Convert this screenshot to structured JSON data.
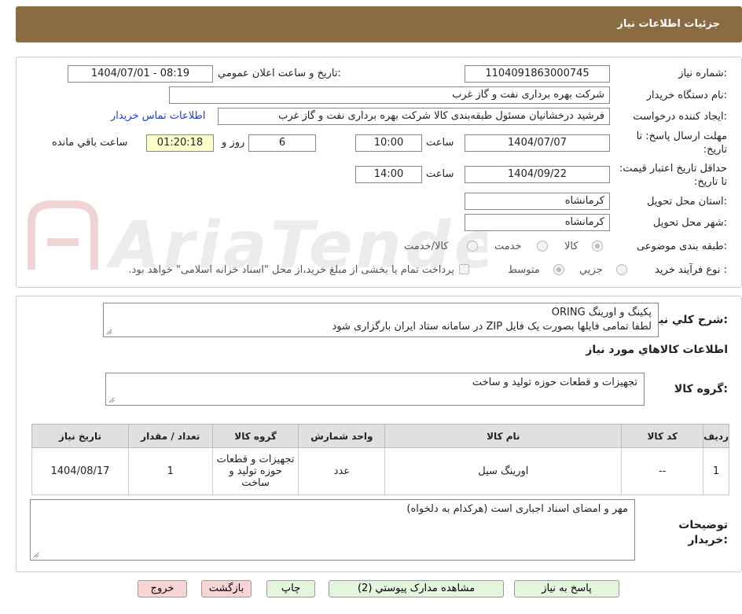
{
  "header": {
    "title": "جزئیات اطلاعات نیاز"
  },
  "labels": {
    "need_number": "شماره نیاز:",
    "announce_datetime": "تاریخ و ساعت اعلان عمومي:",
    "buyer_org": "نام دستگاه خریدار:",
    "requester": "ایجاد کننده درخواست:",
    "deadline": "مهلت ارسال پاسخ: تا تاریخ:",
    "time": "ساعت",
    "day_and": "روز و",
    "remaining": "ساعت باقي مانده",
    "validity": "حداقل تاریخ اعتبار قیمت: تا تاریخ:",
    "province": "استان محل تحویل:",
    "city": "شهر محل تحویل:",
    "category": "طبقه بندی موضوعی:",
    "purchase_type": "نوع فرآیند خرید :",
    "description": "شرح کلي نياز:",
    "goods_info": "اطلاعات کالاهاي مورد نياز",
    "goods_group": "گروه کالا:",
    "buyer_notes": "توضیحات\nخریدار:"
  },
  "fields": {
    "need_number": "1104091863000745",
    "announce_datetime": "1404/07/01 - 08:19",
    "buyer_org": "شرکت بهره برداری نفت و گاز غرب",
    "requester": "فرشید درخشانیان مسئول طبقه‌بندی کالا شرکت بهره برداری نفت و گاز غرب",
    "deadline_date": "1404/07/07",
    "deadline_time": "10:00",
    "deadline_days": "6",
    "remaining_time": "01:20:18",
    "validity_date": "1404/09/22",
    "validity_time": "14:00",
    "province": "کرمانشاه",
    "city": "کرمانشاه"
  },
  "contact_link": "اطلاعات تماس خریدار",
  "category_options": [
    "کالا",
    "خدمت",
    "کالا/خدمت"
  ],
  "purchase_options": [
    "جزیي",
    "متوسط"
  ],
  "purchase_note": "پرداخت تمام یا بخشی از مبلغ خرید،از محل \"اسناد خزانه اسلامی\" خواهد بود.",
  "description": {
    "line1": "پکینگ و اورینگ ORING",
    "line2": "لطفا تمامی فایلها بصورت یک فایل ZIP در سامانه ستاد ایران بارگزاری شود"
  },
  "goods_group_value": "تجهیزات و قطعات حوزه تولید و ساخت",
  "table": {
    "headers": [
      "ردیف",
      "کد کالا",
      "نام کالا",
      "واحد شمارش",
      "گروه کالا",
      "تعداد / مقدار",
      "تاریخ نیاز"
    ],
    "row": [
      "1",
      "--",
      "اورینگ سیل",
      "عدد",
      "تجهیزات و قطعات حوزه تولید و ساخت",
      "1",
      "1404/08/17"
    ]
  },
  "buyer_notes_value": "مهر و امضای اسناد اجباری است (هرکدام به دلخواه)",
  "buttons": {
    "reply": "پاسخ به نیاز",
    "attachments": "مشاهده مدارک پیوستي (2)",
    "print": "چاپ",
    "back": "بازگشت",
    "exit": "خروج"
  },
  "colors": {
    "header": "#8B6B42",
    "green_button": "#E3F5DC",
    "pink_button": "#F8D4D4",
    "remaining_bg": "#FFFFCC",
    "link": "#1a3fcc"
  }
}
